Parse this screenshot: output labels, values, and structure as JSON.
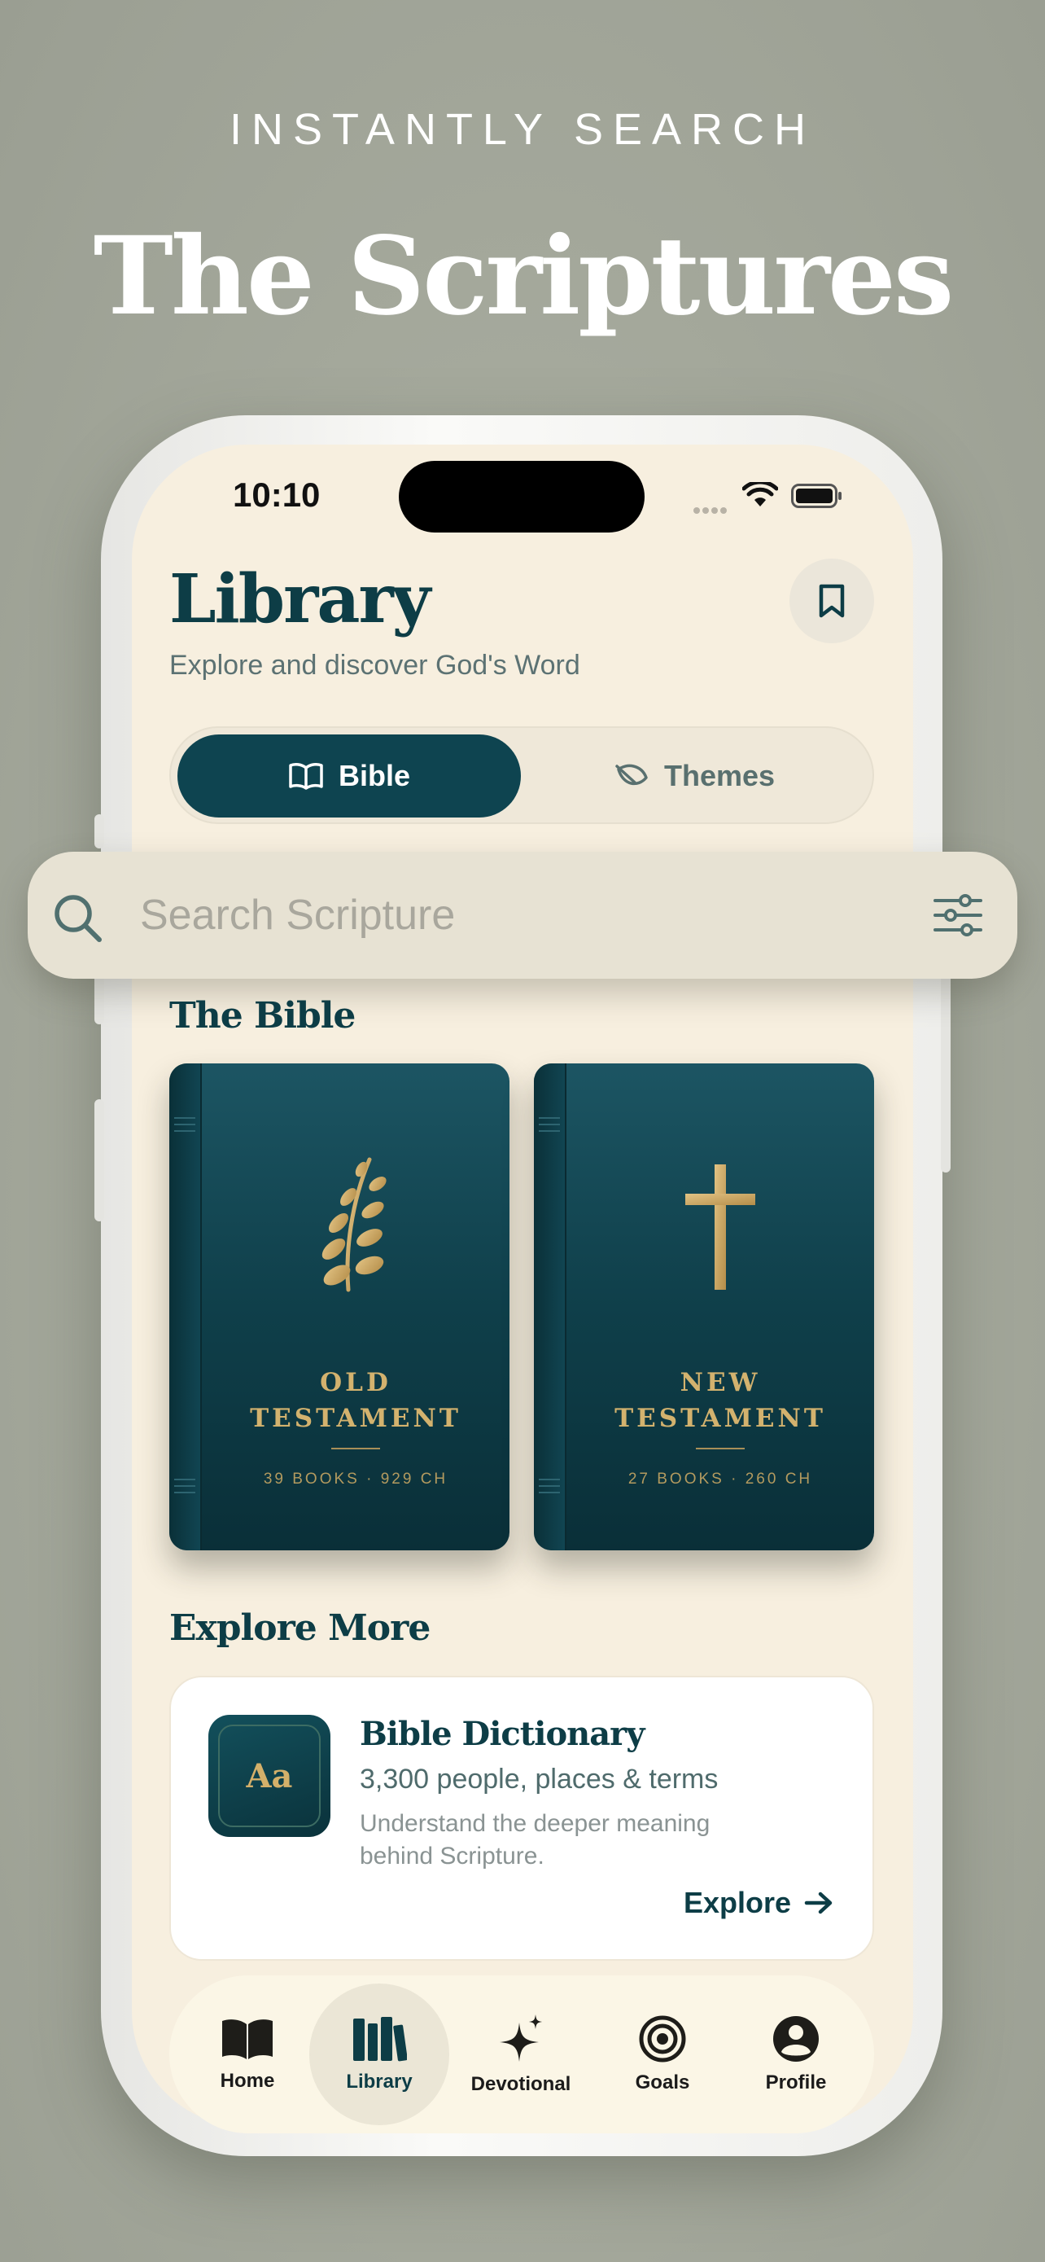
{
  "hero": {
    "kicker": "INSTANTLY SEARCH",
    "headline": "The Scriptures"
  },
  "status_bar": {
    "time": "10:10"
  },
  "header": {
    "title": "Library",
    "subtitle": "Explore and discover God's Word",
    "bookmark_icon": "bookmark-icon"
  },
  "segmented": {
    "active": "Bible",
    "items": [
      {
        "label": "Bible",
        "icon": "open-book-icon"
      },
      {
        "label": "Themes",
        "icon": "leaf-icon"
      }
    ]
  },
  "search": {
    "placeholder": "Search Scripture",
    "icon": "search-icon",
    "filter_icon": "sliders-icon"
  },
  "bible_section": {
    "title": "The Bible",
    "books": [
      {
        "title_line1": "OLD",
        "title_line2": "TESTAMENT",
        "meta": "39 BOOKS · 929 CH",
        "emblem": "olive-branch-icon"
      },
      {
        "title_line1": "NEW",
        "title_line2": "TESTAMENT",
        "meta": "27 BOOKS · 260 CH",
        "emblem": "cross-icon"
      }
    ]
  },
  "explore_section": {
    "title": "Explore More",
    "card": {
      "icon_text": "Aa",
      "title": "Bible Dictionary",
      "subtitle": "3,300 people, places & terms",
      "description": "Understand the deeper meaning behind Scripture.",
      "action": "Explore"
    }
  },
  "tabbar": {
    "active": "Library",
    "items": [
      {
        "label": "Home",
        "icon": "open-book-icon"
      },
      {
        "label": "Library",
        "icon": "books-icon"
      },
      {
        "label": "Devotional",
        "icon": "sparkle-icon"
      },
      {
        "label": "Goals",
        "icon": "target-icon"
      },
      {
        "label": "Profile",
        "icon": "user-icon"
      }
    ]
  },
  "colors": {
    "background": "#a6aa9d",
    "screen": "#f7efdf",
    "primary": "#0e4450",
    "gold": "#d3b26e",
    "search_bar": "#e7e2d3"
  }
}
